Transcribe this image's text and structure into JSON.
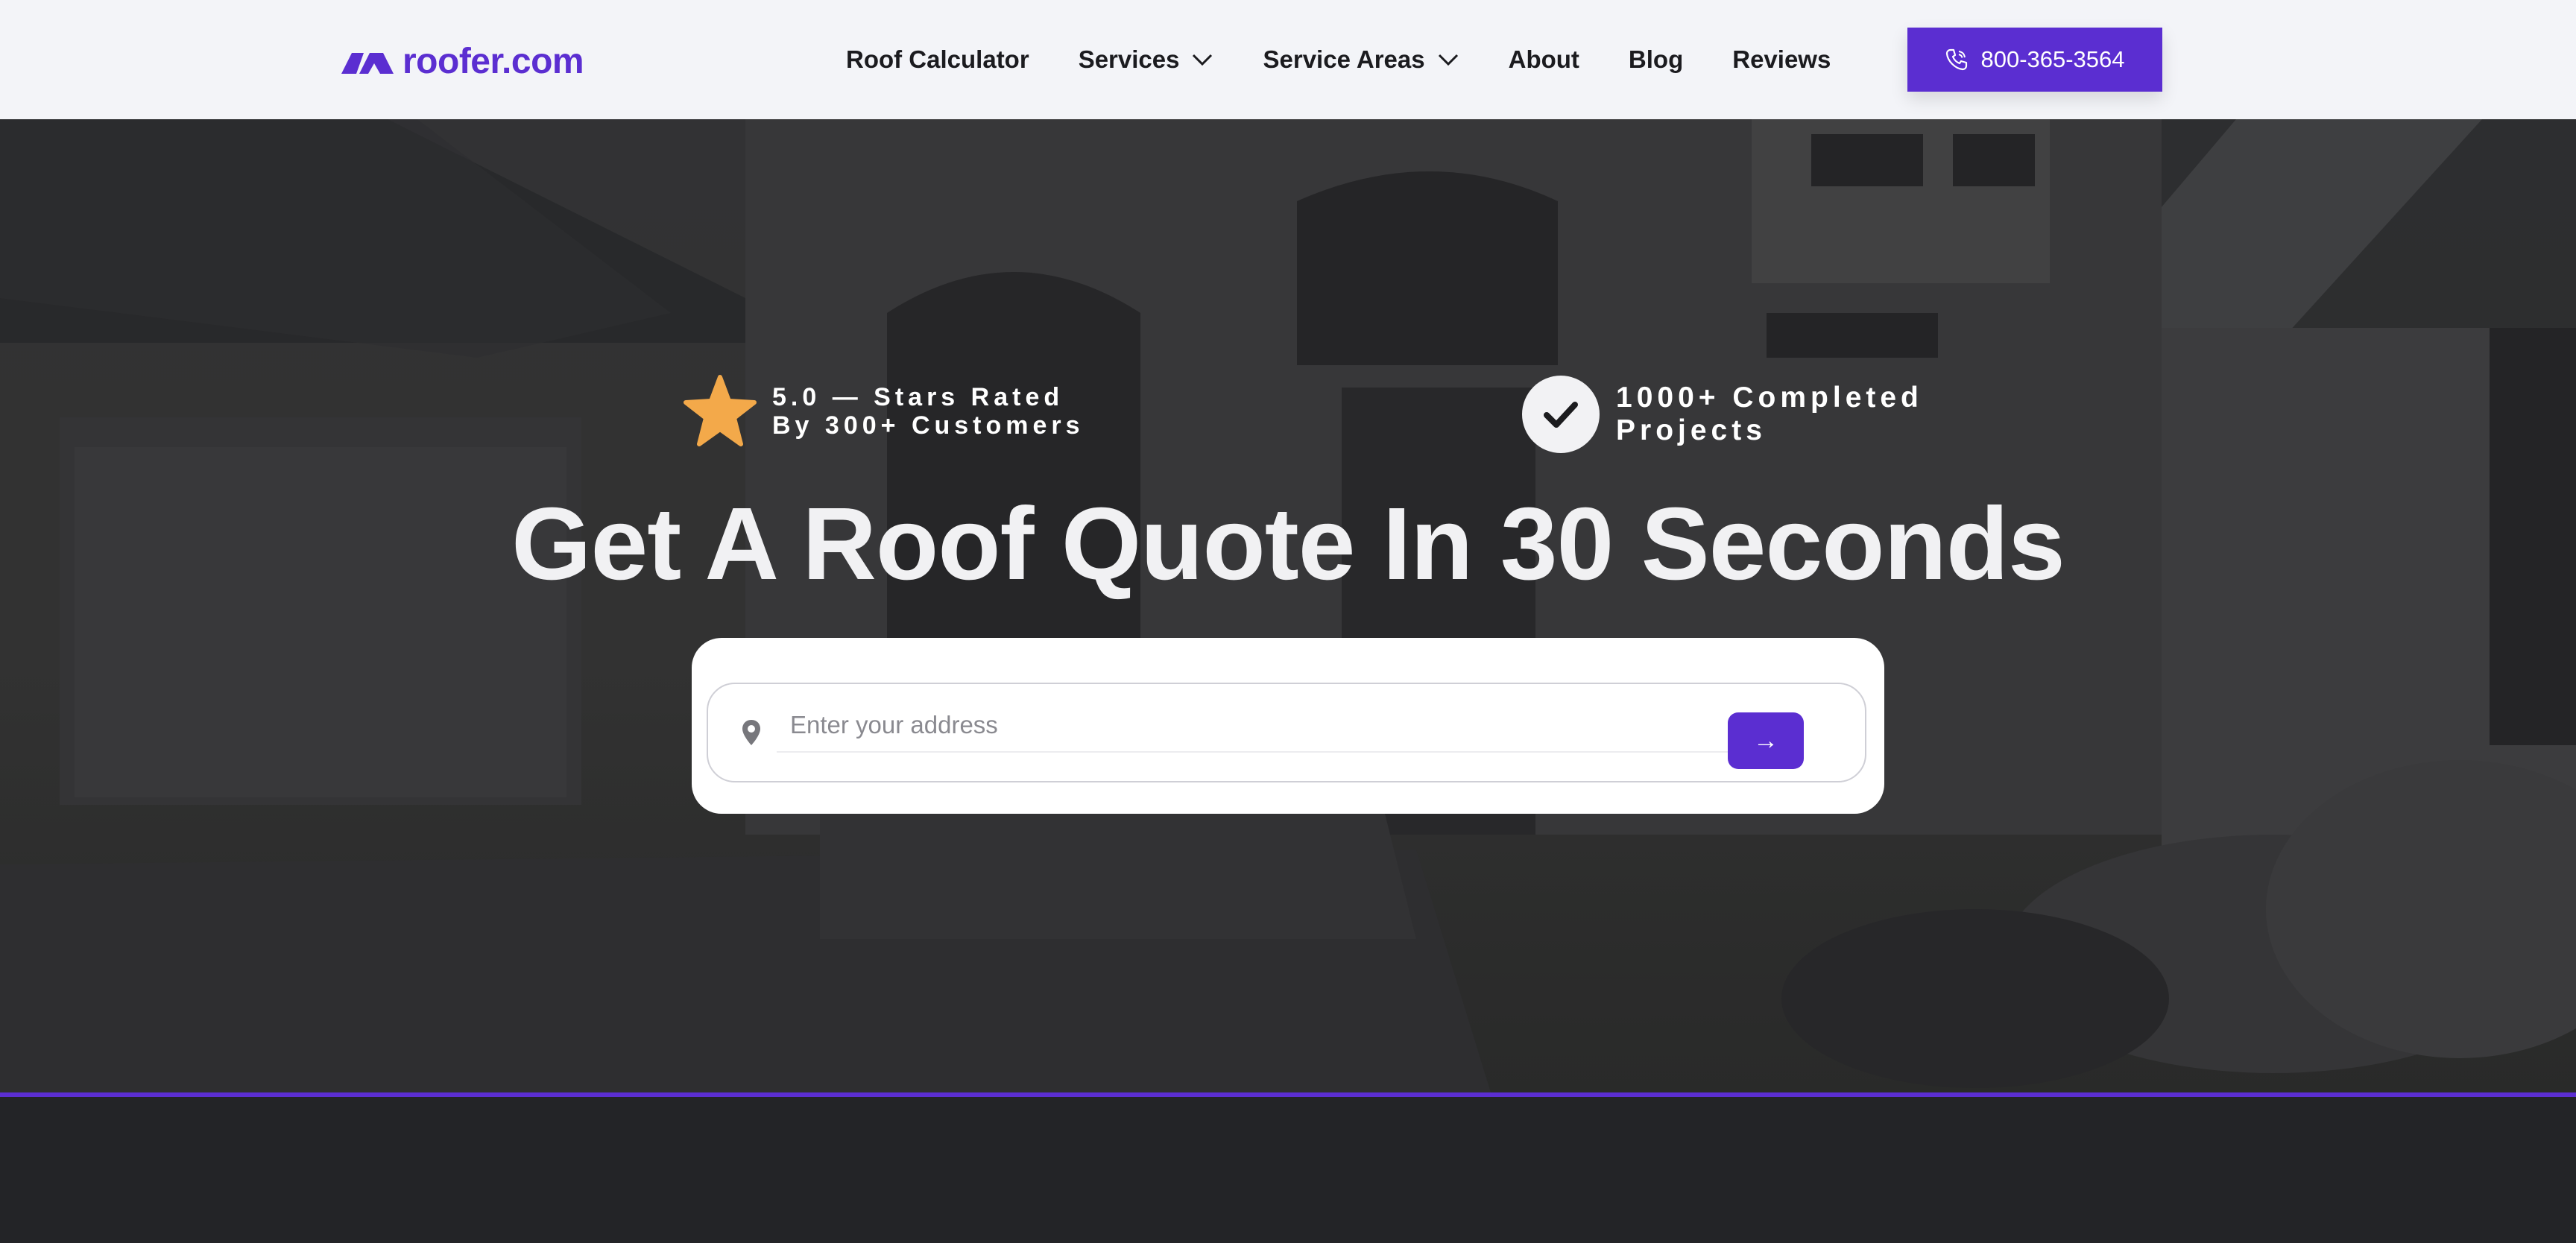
{
  "brand": {
    "name": "roofer.com",
    "color": "#5b2ed1"
  },
  "nav": {
    "items": [
      {
        "label": "Roof Calculator",
        "dropdown": false
      },
      {
        "label": "Services",
        "dropdown": true
      },
      {
        "label": "Service Areas",
        "dropdown": true
      },
      {
        "label": "About",
        "dropdown": false
      },
      {
        "label": "Blog",
        "dropdown": false
      },
      {
        "label": "Reviews",
        "dropdown": false
      }
    ],
    "phone": "800-365-3564",
    "phone_icon": "phone-icon"
  },
  "hero": {
    "rating_line1": "5.0 — Stars Rated",
    "rating_line2": "By 300+ Customers",
    "rating_icon": "star-icon",
    "projects_line1": "1000+ Completed",
    "projects_line2": "Projects",
    "projects_icon": "check-icon",
    "headline": "Get A Roof Quote In 30 Seconds",
    "search": {
      "placeholder": "Enter your address",
      "value": "",
      "pin_icon": "location-pin-icon",
      "submit_label": "→"
    },
    "accent_line_color": "#5b2ed1",
    "star_color": "#f3a94a"
  }
}
